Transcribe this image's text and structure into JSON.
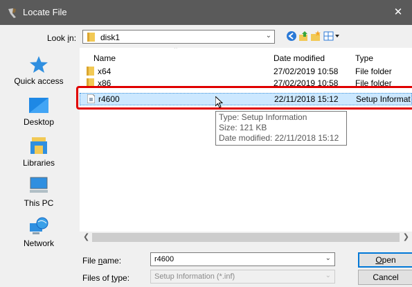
{
  "window": {
    "title": "Locate File",
    "close_glyph": "✕"
  },
  "look_in": {
    "label_prefix": "Look ",
    "label_accel": "i",
    "label_suffix": "n:",
    "value": "disk1"
  },
  "places": [
    {
      "label": "Quick access",
      "icon": "star-icon"
    },
    {
      "label": "Desktop",
      "icon": "desktop-icon"
    },
    {
      "label": "Libraries",
      "icon": "libraries-icon"
    },
    {
      "label": "This PC",
      "icon": "computer-icon"
    },
    {
      "label": "Network",
      "icon": "network-icon"
    }
  ],
  "columns": {
    "name": "Name",
    "date": "Date modified",
    "type": "Type"
  },
  "files": [
    {
      "name": "x64",
      "date": "27/02/2019 10:58",
      "type": "File folder",
      "icon": "folder-icon"
    },
    {
      "name": "x86",
      "date": "27/02/2019 10:58",
      "type": "File folder",
      "icon": "folder-icon"
    },
    {
      "name": "r4600",
      "date": "22/11/2018 15:12",
      "type": "Setup Informat",
      "icon": "setup-file-icon",
      "selected": true
    }
  ],
  "tooltip": {
    "type": "Type: Setup Information",
    "size": "Size: 121 KB",
    "date": "Date modified: 22/11/2018 15:12"
  },
  "file_name": {
    "label_prefix": "File ",
    "label_accel": "n",
    "label_suffix": "ame:",
    "value": "r4600"
  },
  "file_type": {
    "label_prefix": "Files of ",
    "label_accel": "t",
    "label_suffix": "ype:",
    "value": "Setup Information (*.inf)"
  },
  "buttons": {
    "open_accel": "O",
    "open_rest": "pen",
    "cancel": "Cancel"
  },
  "colors": {
    "titlebar": "#5a5a5a",
    "selection": "#cce8ff",
    "highlight_box": "#e00000",
    "accent": "#0078d7"
  }
}
